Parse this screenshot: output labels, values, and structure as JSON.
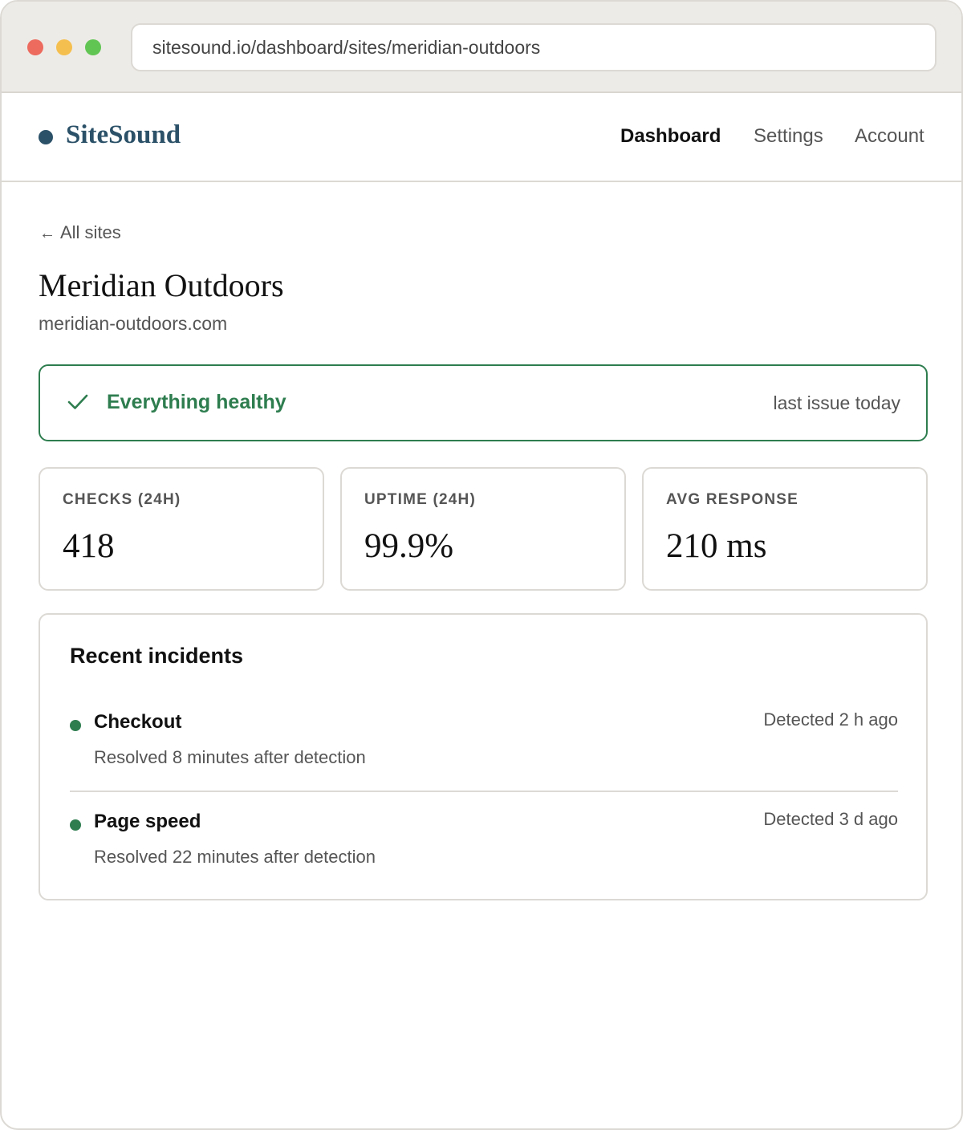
{
  "browser": {
    "url": "sitesound.io/dashboard/sites/meridian-outdoors",
    "window_buttons": [
      "close",
      "minimize",
      "maximize"
    ]
  },
  "header": {
    "brand": "SiteSound",
    "nav": [
      {
        "label": "Dashboard",
        "active": true
      },
      {
        "label": "Settings",
        "active": false
      },
      {
        "label": "Account",
        "active": false
      }
    ]
  },
  "breadcrumb": {
    "arrow": "←",
    "label": "All sites"
  },
  "site": {
    "name": "Meridian Outdoors",
    "domain": "meridian-outdoors.com"
  },
  "status": {
    "icon": "check-icon",
    "label": "Everything healthy",
    "meta": "last issue today",
    "color": "#2e7d4f"
  },
  "stats": [
    {
      "label": "CHECKS (24H)",
      "value": "418"
    },
    {
      "label": "UPTIME (24H)",
      "value": "99.9%"
    },
    {
      "label": "AVG RESPONSE",
      "value": "210 ms"
    }
  ],
  "incidents": {
    "title": "Recent incidents",
    "items": [
      {
        "name": "Checkout",
        "resolved": "Resolved 8 minutes after detection",
        "detected": "Detected 2 h ago",
        "status_color": "#2e7d4f"
      },
      {
        "name": "Page speed",
        "resolved": "Resolved 22 minutes after detection",
        "detected": "Detected 3 d ago",
        "status_color": "#2e7d4f"
      }
    ]
  },
  "colors": {
    "brand": "#2b5168",
    "healthy": "#2e7d4f",
    "border": "#dcd9d4"
  }
}
